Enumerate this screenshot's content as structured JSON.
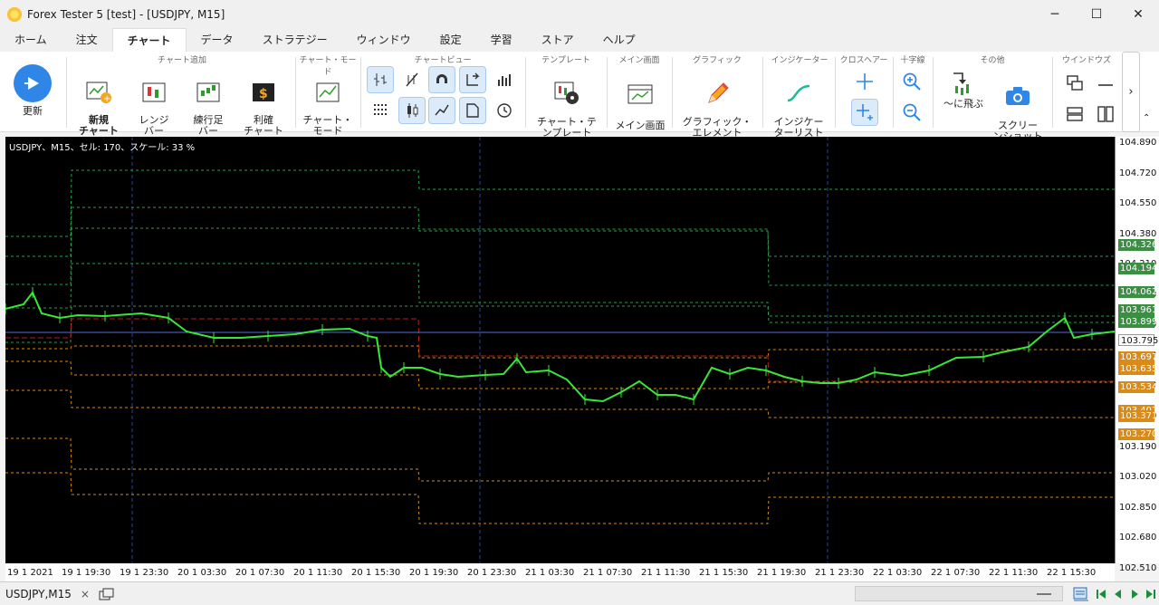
{
  "window": {
    "title": "Forex Tester 5  [test] - [USDJPY, M15]",
    "minimize": "─",
    "maximize": "☐",
    "close": "✕"
  },
  "menu_tabs": [
    "ホーム",
    "注文",
    "チャート",
    "データ",
    "ストラテジー",
    "ウィンドウ",
    "設定",
    "学習",
    "ストア",
    "ヘルプ"
  ],
  "ribbon": {
    "refresh": "更新",
    "group_add_chart": "チャート追加",
    "new_chart": "新規\nチャート",
    "renko": "レンジ\nバー",
    "line_break": "練行足\nバー",
    "profit_chart": "利確\nチャート",
    "group_chart_mode": "チャート・モード",
    "chart_mode": "チャート・\nモード",
    "group_chart_view": "チャートビュー",
    "group_template": "テンプレート",
    "chart_template": "チャート・テ\nンプレート",
    "group_main_screen": "メイン画面",
    "main_screen": "メイン画面",
    "group_graphics": "グラフィック",
    "graphic_elements": "グラフィック・\nエレメント",
    "group_indicators": "インジケーター",
    "indicator_list": "インジケー\nターリスト",
    "group_crosshair": "クロスヘアー",
    "group_crosshair2": "十字線",
    "group_other": "その他",
    "goto": "〜に飛ぶ",
    "screenshot": "スクリー\nンショット",
    "group_windows": "ウインドウズ"
  },
  "chart": {
    "info": "USDJPY、M15、セル: 170、スケール: 33 %",
    "y_ticks": [
      "104.890",
      "104.720",
      "104.550",
      "104.380",
      "104.210",
      "104.040",
      "103.870",
      "103.700",
      "103.530",
      "103.360",
      "103.190",
      "103.020",
      "102.850",
      "102.680",
      "102.510"
    ],
    "y_badges": [
      {
        "text": "104.326",
        "color": "#3a8f43"
      },
      {
        "text": "104.195",
        "color": "#3a8f43"
      },
      {
        "text": "104.194",
        "color": "#3a8f43"
      },
      {
        "text": "104.062",
        "color": "#3a8f43"
      },
      {
        "text": "103.961",
        "color": "#3a8f43"
      },
      {
        "text": "103.899",
        "color": "#3a8f43"
      },
      {
        "text": "103.795",
        "color": "#ffffff"
      },
      {
        "text": "103.697",
        "color": "#d98a18"
      },
      {
        "text": "103.635",
        "color": "#d98a18"
      },
      {
        "text": "103.534",
        "color": "#d98a18"
      },
      {
        "text": "103.402",
        "color": "#d98a18"
      },
      {
        "text": "103.371",
        "color": "#d98a18"
      },
      {
        "text": "103.270",
        "color": "#d98a18"
      }
    ],
    "x_ticks": [
      "19 1 2021",
      "19 1 19:30",
      "19 1 23:30",
      "20 1 03:30",
      "20 1 07:30",
      "20 1 11:30",
      "20 1 15:30",
      "20 1 19:30",
      "20 1 23:30",
      "21 1 03:30",
      "21 1 07:30",
      "21 1 11:30",
      "21 1 15:30",
      "21 1 19:30",
      "21 1 23:30",
      "22 1 03:30",
      "22 1 07:30",
      "22 1 11:30",
      "22 1 15:30"
    ]
  },
  "bottom": {
    "doc_tab": "USDJPY,M15",
    "close": "×"
  }
}
